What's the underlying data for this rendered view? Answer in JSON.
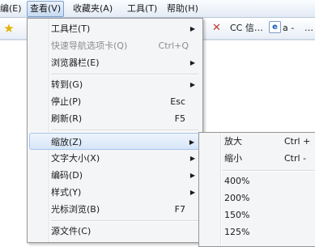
{
  "menubar": {
    "items": [
      {
        "label": "编(E)",
        "active": false
      },
      {
        "label": "查看(V)",
        "active": true
      },
      {
        "label": "收藏夹(A)",
        "active": false
      },
      {
        "label": "工具(T)",
        "active": false
      },
      {
        "label": "帮助(H)",
        "active": false
      }
    ]
  },
  "toolbar": {
    "fav1": "CC 信…",
    "fav2": "a -",
    "fav3": "…"
  },
  "view_menu": {
    "items": [
      {
        "label": "工具栏(T)",
        "shortcut": "",
        "arrow": true
      },
      {
        "label": "快速导航选项卡(Q)",
        "shortcut": "Ctrl+Q",
        "disabled": true
      },
      {
        "label": "浏览器栏(E)",
        "shortcut": "",
        "arrow": true
      },
      {
        "label": "转到(G)",
        "shortcut": "",
        "arrow": true
      },
      {
        "label": "停止(P)",
        "shortcut": "Esc"
      },
      {
        "label": "刷新(R)",
        "shortcut": "F5"
      },
      {
        "label": "缩放(Z)",
        "shortcut": "",
        "arrow": true,
        "highlighted": true
      },
      {
        "label": "文字大小(X)",
        "shortcut": "",
        "arrow": true
      },
      {
        "label": "编码(D)",
        "shortcut": "",
        "arrow": true
      },
      {
        "label": "样式(Y)",
        "shortcut": "",
        "arrow": true
      },
      {
        "label": "光标浏览(B)",
        "shortcut": "F7"
      },
      {
        "label": "源文件(C)",
        "shortcut": ""
      }
    ]
  },
  "zoom_menu": {
    "items": [
      {
        "label": "放大",
        "shortcut": "Ctrl +"
      },
      {
        "label": "缩小",
        "shortcut": "Ctrl -"
      },
      {
        "label": "400%",
        "shortcut": ""
      },
      {
        "label": "200%",
        "shortcut": ""
      },
      {
        "label": "150%",
        "shortcut": ""
      },
      {
        "label": "125%",
        "shortcut": ""
      }
    ]
  },
  "arrow_glyph": "▶",
  "colors": {
    "highlight_border": "#a9c6ec",
    "menu_bg": "#f4f5f7",
    "disabled_text": "#8d8d8d"
  }
}
